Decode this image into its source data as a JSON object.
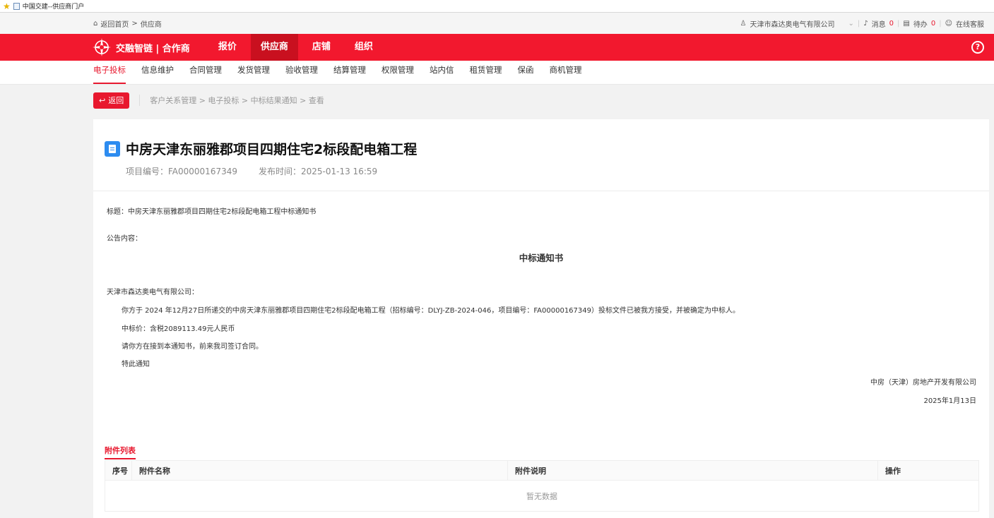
{
  "browser": {
    "title": "中国交建--供应商门户"
  },
  "util": {
    "home_link": "返回首页",
    "crumb_sep": ">",
    "crumb_current": "供应商",
    "company": "天津市森达奥电气有限公司",
    "messages_label": "消息",
    "messages_count": "0",
    "todo_label": "待办",
    "todo_count": "0",
    "service_label": "在线客服"
  },
  "nav": {
    "logo_text": "交融智链 | 合作商",
    "items": [
      "报价",
      "供应商",
      "店铺",
      "组织"
    ],
    "help": "?"
  },
  "subnav": {
    "items": [
      "电子投标",
      "信息维护",
      "合同管理",
      "发货管理",
      "验收管理",
      "结算管理",
      "权限管理",
      "站内信",
      "租赁管理",
      "保函",
      "商机管理"
    ]
  },
  "crumbs": {
    "back_label": "返回",
    "path": "客户关系管理 > 电子投标 > 中标结果通知 > 查看"
  },
  "header": {
    "title": "中房天津东丽雅郡项目四期住宅2标段配电箱工程",
    "project_no": "项目编号：FA00000167349",
    "publish_time": "发布时间：2025-01-13 16:59"
  },
  "notice": {
    "subject": "标题：中房天津东丽雅郡项目四期住宅2标段配电箱工程中标通知书",
    "content_label": "公告内容：",
    "doc_title": "中标通知书",
    "recipient": "天津市森达奥电气有限公司：",
    "para1": "你方于 2024 年12月27日所递交的中房天津东丽雅郡项目四期住宅2标段配电箱工程（招标编号：DLYJ-ZB-2024-046，项目编号：FA00000167349）投标文件已被我方接受，并被确定为中标人。",
    "para2": "中标价：含税2089113.49元人民币",
    "para3": "请你方在接到本通知书，前来我司签订合同。",
    "para4": "特此通知",
    "signer": "中房（天津）房地产开发有限公司",
    "date": "2025年1月13日"
  },
  "attachments": {
    "title": "附件列表",
    "columns": [
      "序号",
      "附件名称",
      "附件说明",
      "操作"
    ],
    "empty_text": "暂无数据"
  },
  "colors": {
    "brand": "#f2182e",
    "accent_blue": "#2d8cf0"
  }
}
